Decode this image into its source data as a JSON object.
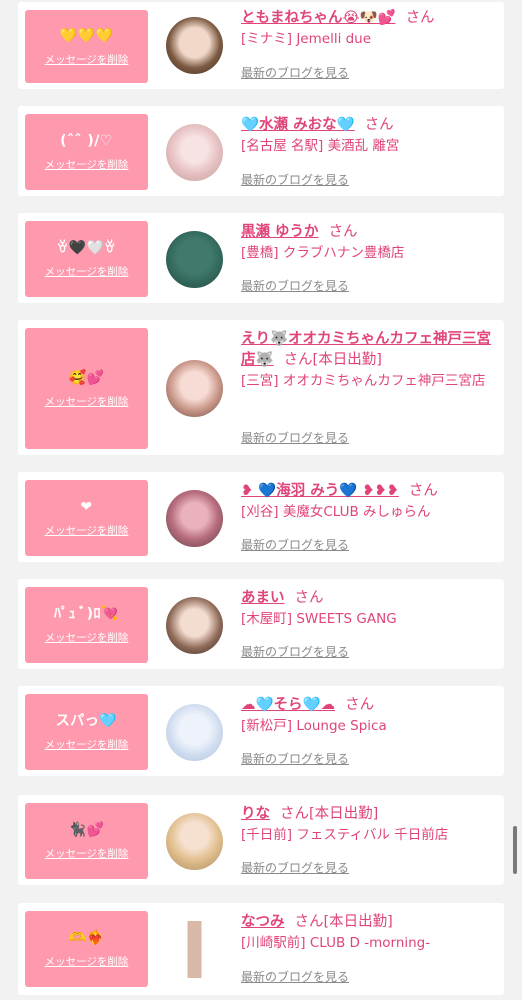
{
  "delete_label": "メッセージを削除",
  "blog_label": "最新のブログを見る",
  "items": [
    {
      "stamp": "💛💛💛",
      "name": "ともまねちゃん😭🐶💕",
      "suffix": "さん",
      "shop": "[ミナミ] Jemelli due"
    },
    {
      "stamp": "(ˆˆ )/♡",
      "name": "🩵水瀬 みおな🩵",
      "suffix": "さん",
      "shop": "[名古屋 名駅] 美酒乱 離宮"
    },
    {
      "stamp": "ꈊ🖤🤍ꈊ",
      "name": "黒瀬 ゆうか",
      "suffix": "さん",
      "shop": "[豊橋] クラブハナン豊橋店"
    },
    {
      "stamp": "🥰💕",
      "name": "えり🐺オオカミちゃんカフェ神戸三宮店🐺",
      "suffix": "さん[本日出勤]",
      "shop": "[三宮] オオカミちゃんカフェ神戸三宮店"
    },
    {
      "stamp": "❤",
      "name": "❥ 💙海羽 みう💙 ❥❥❥",
      "suffix": "さん",
      "shop": "[刈谷] 美魔女CLUB みしゅらん"
    },
    {
      "stamp": "ﾊﾟｭ ﾞ)ﾛ💘",
      "name": "あまい",
      "suffix": "さん",
      "shop": "[木屋町] SWEETS GANG"
    },
    {
      "stamp": "スパっ🩵",
      "name": "☁🩵そら🩵☁",
      "suffix": "さん",
      "shop": "[新松戸] Lounge Spica"
    },
    {
      "stamp": "🐈‍⬛💕",
      "name": "りな",
      "suffix": "さん[本日出勤]",
      "shop": "[千日前] フェスティバル 千日前店"
    },
    {
      "stamp": "🫶❤‍🔥",
      "name": "なつみ",
      "suffix": "さん[本日出勤]",
      "shop": "[川崎駅前] CLUB D -morning-"
    }
  ]
}
